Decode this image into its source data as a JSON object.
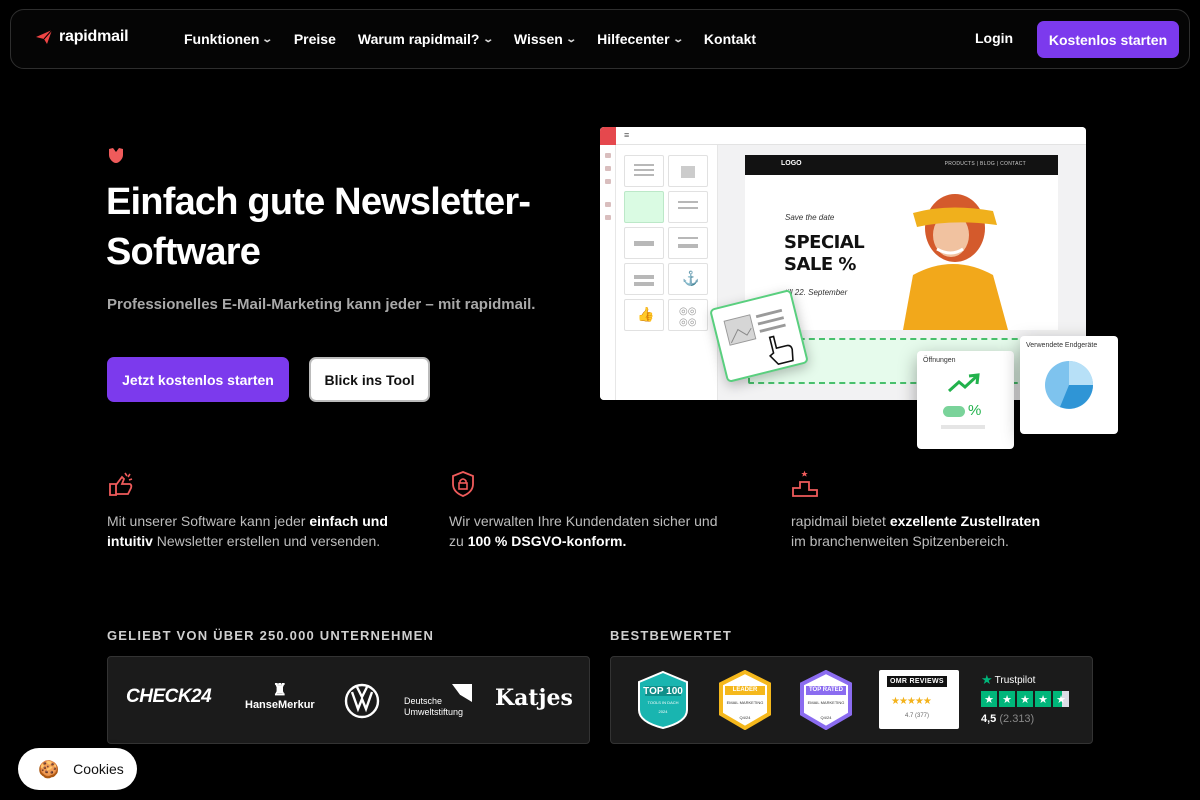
{
  "nav": {
    "logo_text": "rapidmail",
    "items": [
      {
        "label": "Funktionen",
        "dropdown": true
      },
      {
        "label": "Preise",
        "dropdown": false
      },
      {
        "label": "Warum rapidmail?",
        "dropdown": true
      },
      {
        "label": "Wissen",
        "dropdown": true
      },
      {
        "label": "Hilfecenter",
        "dropdown": true
      },
      {
        "label": "Kontakt",
        "dropdown": false
      }
    ],
    "login": "Login",
    "cta": "Kostenlos starten"
  },
  "hero": {
    "title": "Einfach gute Newsletter-Software",
    "subtitle": "Professionelles E-Mail-Marketing kann jeder – mit rapidmail.",
    "primary_button": "Jetzt kostenlos starten",
    "secondary_button": "Blick ins Tool"
  },
  "mockup": {
    "logo": "LOGO",
    "links": "PRODUCTS | BLOG | CONTACT",
    "save_the_date": "Save the date",
    "special_line1": "SPECIAL",
    "special_line2": "SALE %",
    "till": "till 22. September",
    "card_opens_title": "Öffnungen",
    "card_opens_value": "%",
    "card_devices_title": "Verwendete Endgeräte"
  },
  "features": [
    {
      "icon": "thumbs-up-icon",
      "pre": "Mit unserer Software kann jeder ",
      "strong": "einfach und intuitiv",
      "post": " Newsletter erstellen und versenden.",
      "break_before_strong": false
    },
    {
      "icon": "shield-lock-icon",
      "pre": "Wir verwalten Ihre Kundendaten sicher und zu ",
      "strong": "100 % DSGVO-konform.",
      "post": "",
      "break_before_strong": false
    },
    {
      "icon": "podium-icon",
      "pre": "rapidmail bietet ",
      "strong": "exzellente Zustellraten",
      "post": " im branchenweiten Spitzenbereich.",
      "break_before_strong": false
    }
  ],
  "trust": {
    "label": "GELIEBT VON ÜBER 250.000 UNTERNEHMEN",
    "brands": [
      "CHECK24",
      "HanseMerkur",
      "VW",
      "Deutsche Umweltstiftung",
      "Katjes"
    ]
  },
  "rated": {
    "label": "BESTBEWERTET",
    "badges": [
      {
        "name": "TOP 100",
        "sub": "TOOLS IN DACH",
        "year": "2024",
        "color": "#19b5b0"
      },
      {
        "name": "LEADER",
        "sub": "EMAIL MARKETING",
        "year": "Q4/24",
        "color": "#f5b81c"
      },
      {
        "name": "TOP RATED",
        "sub": "EMAIL MARKETING",
        "year": "Q4/24",
        "color": "#8b6cf0"
      }
    ],
    "omr": {
      "title": "REVIEWS",
      "stars": "★★★★★",
      "score": "4.7 (377)"
    },
    "trustpilot": {
      "name": "Trustpilot",
      "score": "4,5",
      "count": "(2.313)"
    }
  },
  "cookie": {
    "label": "Cookies"
  },
  "colors": {
    "accent": "#7c3aed",
    "highlight": "#ef5b5b",
    "green": "#00b67a"
  }
}
